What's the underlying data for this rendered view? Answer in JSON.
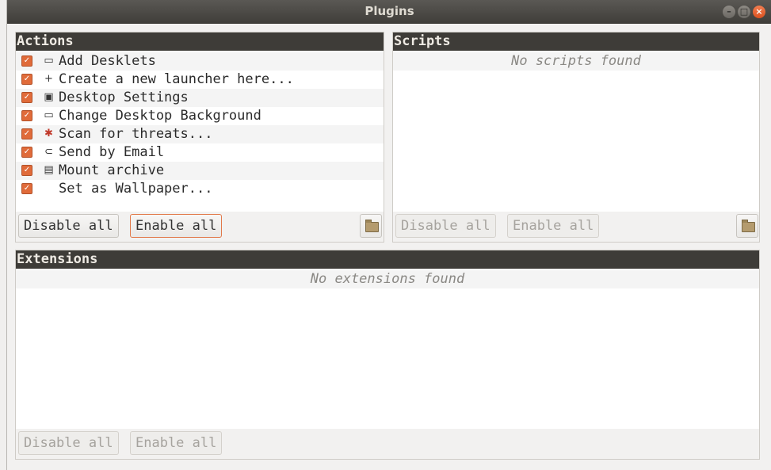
{
  "window": {
    "title": "Plugins",
    "controls": [
      "minimize",
      "maximize",
      "close"
    ]
  },
  "actions_panel": {
    "header": "Actions",
    "items": [
      {
        "label": "Add Desklets",
        "checked": true,
        "icon": "desklet-icon"
      },
      {
        "label": "Create a new launcher here...",
        "checked": true,
        "icon": "plus-icon"
      },
      {
        "label": "Desktop Settings",
        "checked": true,
        "icon": "desktop-settings-icon"
      },
      {
        "label": "Change Desktop Background",
        "checked": true,
        "icon": "monitor-icon"
      },
      {
        "label": "Scan for threats...",
        "checked": true,
        "icon": "antivirus-icon"
      },
      {
        "label": "Send by Email",
        "checked": true,
        "icon": "paperclip-icon"
      },
      {
        "label": "Mount archive",
        "checked": true,
        "icon": "archive-icon"
      },
      {
        "label": "Set as Wallpaper...",
        "checked": true,
        "icon": ""
      }
    ],
    "disable_all": "Disable all",
    "enable_all": "Enable all"
  },
  "scripts_panel": {
    "header": "Scripts",
    "empty_text": "No scripts found",
    "disable_all": "Disable all",
    "enable_all": "Enable all"
  },
  "extensions_panel": {
    "header": "Extensions",
    "empty_text": "No extensions found",
    "disable_all": "Disable all",
    "enable_all": "Enable all"
  },
  "colors": {
    "header_bg": "#3e3c38",
    "accent": "#e06b3a",
    "close_button": "#e8622f"
  }
}
